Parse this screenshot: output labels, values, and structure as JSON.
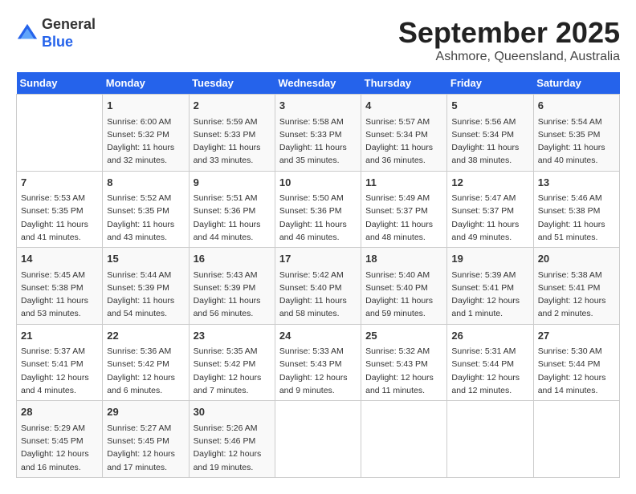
{
  "logo": {
    "general": "General",
    "blue": "Blue"
  },
  "header": {
    "month": "September 2025",
    "location": "Ashmore, Queensland, Australia"
  },
  "weekdays": [
    "Sunday",
    "Monday",
    "Tuesday",
    "Wednesday",
    "Thursday",
    "Friday",
    "Saturday"
  ],
  "weeks": [
    [
      {
        "day": "",
        "info": ""
      },
      {
        "day": "1",
        "info": "Sunrise: 6:00 AM\nSunset: 5:32 PM\nDaylight: 11 hours\nand 32 minutes."
      },
      {
        "day": "2",
        "info": "Sunrise: 5:59 AM\nSunset: 5:33 PM\nDaylight: 11 hours\nand 33 minutes."
      },
      {
        "day": "3",
        "info": "Sunrise: 5:58 AM\nSunset: 5:33 PM\nDaylight: 11 hours\nand 35 minutes."
      },
      {
        "day": "4",
        "info": "Sunrise: 5:57 AM\nSunset: 5:34 PM\nDaylight: 11 hours\nand 36 minutes."
      },
      {
        "day": "5",
        "info": "Sunrise: 5:56 AM\nSunset: 5:34 PM\nDaylight: 11 hours\nand 38 minutes."
      },
      {
        "day": "6",
        "info": "Sunrise: 5:54 AM\nSunset: 5:35 PM\nDaylight: 11 hours\nand 40 minutes."
      }
    ],
    [
      {
        "day": "7",
        "info": "Sunrise: 5:53 AM\nSunset: 5:35 PM\nDaylight: 11 hours\nand 41 minutes."
      },
      {
        "day": "8",
        "info": "Sunrise: 5:52 AM\nSunset: 5:35 PM\nDaylight: 11 hours\nand 43 minutes."
      },
      {
        "day": "9",
        "info": "Sunrise: 5:51 AM\nSunset: 5:36 PM\nDaylight: 11 hours\nand 44 minutes."
      },
      {
        "day": "10",
        "info": "Sunrise: 5:50 AM\nSunset: 5:36 PM\nDaylight: 11 hours\nand 46 minutes."
      },
      {
        "day": "11",
        "info": "Sunrise: 5:49 AM\nSunset: 5:37 PM\nDaylight: 11 hours\nand 48 minutes."
      },
      {
        "day": "12",
        "info": "Sunrise: 5:47 AM\nSunset: 5:37 PM\nDaylight: 11 hours\nand 49 minutes."
      },
      {
        "day": "13",
        "info": "Sunrise: 5:46 AM\nSunset: 5:38 PM\nDaylight: 11 hours\nand 51 minutes."
      }
    ],
    [
      {
        "day": "14",
        "info": "Sunrise: 5:45 AM\nSunset: 5:38 PM\nDaylight: 11 hours\nand 53 minutes."
      },
      {
        "day": "15",
        "info": "Sunrise: 5:44 AM\nSunset: 5:39 PM\nDaylight: 11 hours\nand 54 minutes."
      },
      {
        "day": "16",
        "info": "Sunrise: 5:43 AM\nSunset: 5:39 PM\nDaylight: 11 hours\nand 56 minutes."
      },
      {
        "day": "17",
        "info": "Sunrise: 5:42 AM\nSunset: 5:40 PM\nDaylight: 11 hours\nand 58 minutes."
      },
      {
        "day": "18",
        "info": "Sunrise: 5:40 AM\nSunset: 5:40 PM\nDaylight: 11 hours\nand 59 minutes."
      },
      {
        "day": "19",
        "info": "Sunrise: 5:39 AM\nSunset: 5:41 PM\nDaylight: 12 hours\nand 1 minute."
      },
      {
        "day": "20",
        "info": "Sunrise: 5:38 AM\nSunset: 5:41 PM\nDaylight: 12 hours\nand 2 minutes."
      }
    ],
    [
      {
        "day": "21",
        "info": "Sunrise: 5:37 AM\nSunset: 5:41 PM\nDaylight: 12 hours\nand 4 minutes."
      },
      {
        "day": "22",
        "info": "Sunrise: 5:36 AM\nSunset: 5:42 PM\nDaylight: 12 hours\nand 6 minutes."
      },
      {
        "day": "23",
        "info": "Sunrise: 5:35 AM\nSunset: 5:42 PM\nDaylight: 12 hours\nand 7 minutes."
      },
      {
        "day": "24",
        "info": "Sunrise: 5:33 AM\nSunset: 5:43 PM\nDaylight: 12 hours\nand 9 minutes."
      },
      {
        "day": "25",
        "info": "Sunrise: 5:32 AM\nSunset: 5:43 PM\nDaylight: 12 hours\nand 11 minutes."
      },
      {
        "day": "26",
        "info": "Sunrise: 5:31 AM\nSunset: 5:44 PM\nDaylight: 12 hours\nand 12 minutes."
      },
      {
        "day": "27",
        "info": "Sunrise: 5:30 AM\nSunset: 5:44 PM\nDaylight: 12 hours\nand 14 minutes."
      }
    ],
    [
      {
        "day": "28",
        "info": "Sunrise: 5:29 AM\nSunset: 5:45 PM\nDaylight: 12 hours\nand 16 minutes."
      },
      {
        "day": "29",
        "info": "Sunrise: 5:27 AM\nSunset: 5:45 PM\nDaylight: 12 hours\nand 17 minutes."
      },
      {
        "day": "30",
        "info": "Sunrise: 5:26 AM\nSunset: 5:46 PM\nDaylight: 12 hours\nand 19 minutes."
      },
      {
        "day": "",
        "info": ""
      },
      {
        "day": "",
        "info": ""
      },
      {
        "day": "",
        "info": ""
      },
      {
        "day": "",
        "info": ""
      }
    ]
  ]
}
